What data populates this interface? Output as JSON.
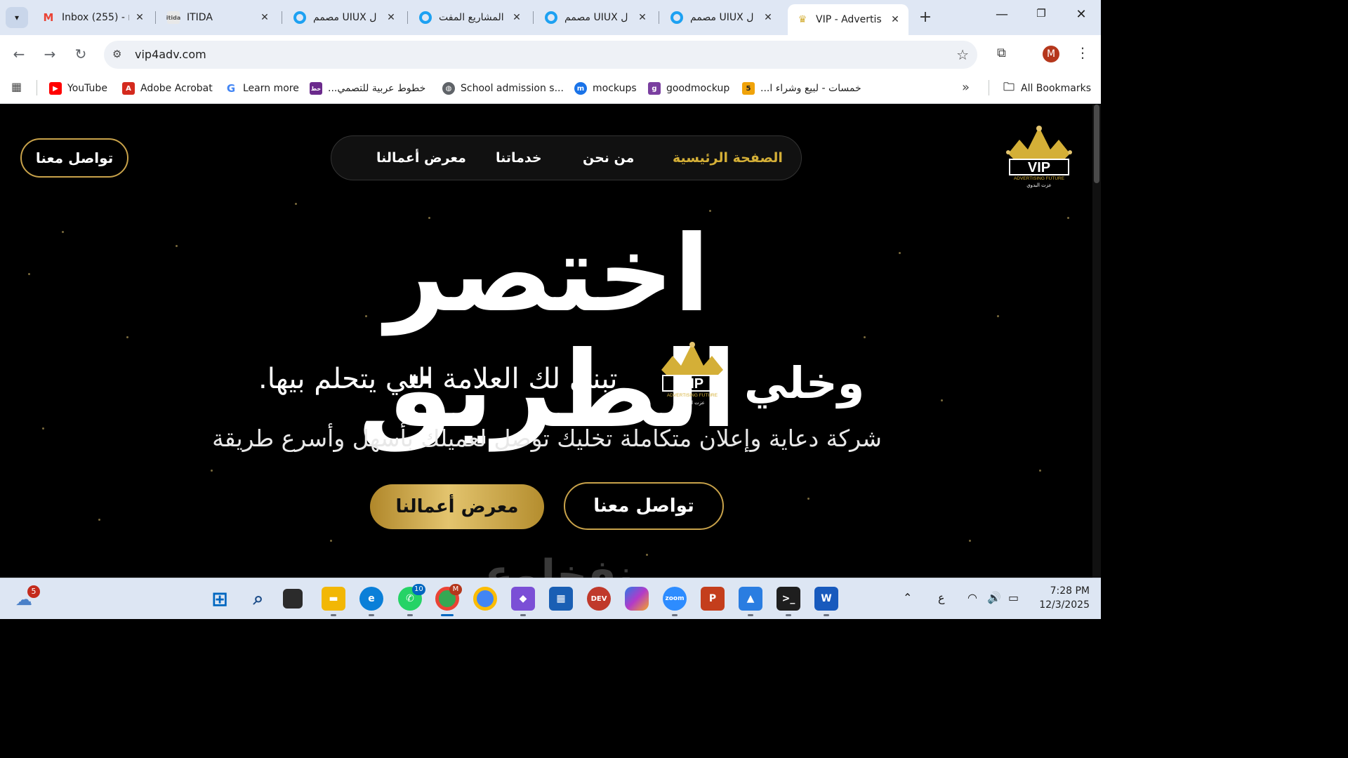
{
  "browser": {
    "tabs": [
      {
        "title": "Inbox (255) - r",
        "icon": "gmail-icon",
        "active": false
      },
      {
        "title": "ITIDA",
        "icon": "itida-icon",
        "active": false
      },
      {
        "title": "مصمم UIUX ل",
        "icon": "chrome-circle-icon",
        "active": false
      },
      {
        "title": "المشاريع المفت",
        "icon": "chrome-circle-icon",
        "active": false
      },
      {
        "title": "مصمم UIUX ل",
        "icon": "chrome-circle-icon",
        "active": false
      },
      {
        "title": "مصمم UIUX ل",
        "icon": "chrome-circle-icon",
        "active": false
      },
      {
        "title": "VIP - Advertis",
        "icon": "vip-crown-icon",
        "active": true
      }
    ],
    "url": "vip4adv.com",
    "profile_initial": "M",
    "bookmarks": [
      {
        "label": "YouTube",
        "icon": "youtube-icon",
        "color": "#ff0000"
      },
      {
        "label": "Adobe Acrobat",
        "icon": "acrobat-icon",
        "color": "#d42a1e"
      },
      {
        "label": "Learn more",
        "icon": "google-icon",
        "color": "#4285f4"
      },
      {
        "label": "خطوط عربية للتصمي...",
        "icon": "arabic-fonts-icon",
        "color": "#6b2a8c"
      },
      {
        "label": "School admission s...",
        "icon": "globe-icon",
        "color": "#5f6368"
      },
      {
        "label": "mockups",
        "icon": "mockups-icon",
        "color": "#1a73e8"
      },
      {
        "label": "goodmockup",
        "icon": "goodmockup-icon",
        "color": "#7a3fa0"
      },
      {
        "label": "خمسات - لبيع وشراء ا...",
        "icon": "khamsat-icon",
        "color": "#f0a30a"
      }
    ],
    "all_bookmarks": "All Bookmarks"
  },
  "site": {
    "nav": {
      "home": "الصفحة الرئيسية",
      "about": "من نحن",
      "services": "خدماتنا",
      "portfolio": "معرض أعمالنا"
    },
    "header_contact": "تواصل معنا",
    "hero": {
      "title": "اختصر الطريق",
      "line2_start": "وخلي",
      "line2_end": "تبني لك العلامة التي يتحلم بيها.",
      "subtitle": "شركة دعاية وإعلان متكاملة تخليك توصل لعميلك بأسهل وأسرع طريقة",
      "btn_portfolio": "معرض أعمالنا",
      "btn_contact": "تواصل معنا",
      "next_section_peek": "نفخلوع"
    },
    "logo": {
      "text": "VIP",
      "tagline": "ADVERTISING FUTURE",
      "signature": "عزت البدوي"
    },
    "colors": {
      "gold": "#d4af37",
      "background": "#000000"
    }
  },
  "taskbar": {
    "weather_badge": "5",
    "whatsapp_badge": "10",
    "chrome_badge": "M",
    "lang": "ع",
    "time": "7:28 PM",
    "date": "12/3/2025"
  }
}
